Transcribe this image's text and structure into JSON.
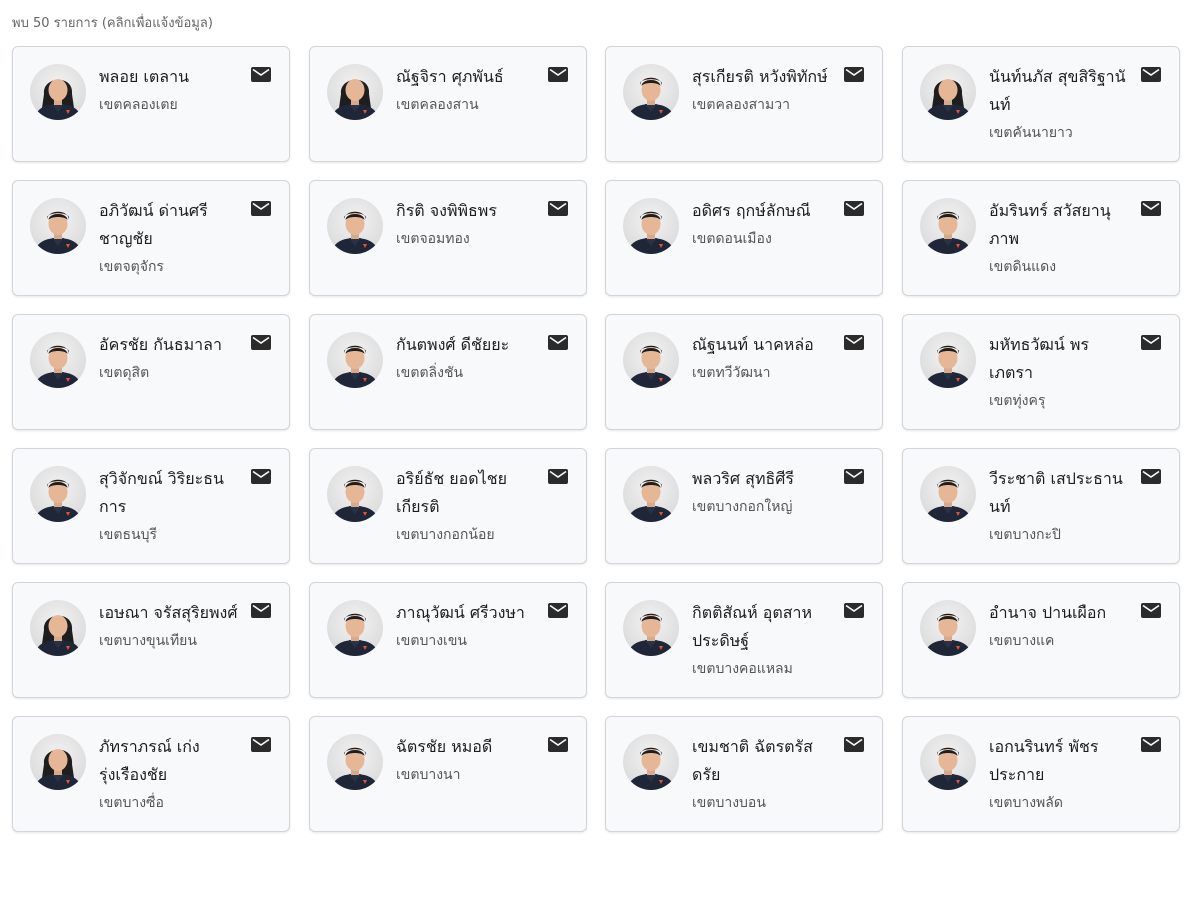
{
  "summary": "พบ 50 รายการ (คลิกเพื่อแจ้งข้อมูล)",
  "icon_names": {
    "contact": "mail-icon",
    "photo": "avatar"
  },
  "members": [
    {
      "name": "พลอย เตลาน",
      "district": "เขตคลองเตย",
      "gender": "f"
    },
    {
      "name": "ณัฐจิรา ศุภพันธ์",
      "district": "เขตคลองสาน",
      "gender": "f"
    },
    {
      "name": "สุรเกียรติ หวังพิทักษ์",
      "district": "เขตคลองสามวา",
      "gender": "m"
    },
    {
      "name": "นันท์นภัส สุขสิริฐานันท์",
      "district": "เขตคันนายาว",
      "gender": "f"
    },
    {
      "name": "อภิวัฒน์ ด่านศรีชาญชัย",
      "district": "เขตจตุจักร",
      "gender": "m"
    },
    {
      "name": "กิรติ จงพิพิธพร",
      "district": "เขตจอมทอง",
      "gender": "m"
    },
    {
      "name": "อดิศร ฤกษ์ลักษณี",
      "district": "เขตดอนเมือง",
      "gender": "m"
    },
    {
      "name": "อัมรินทร์ สวัสยานุภาพ",
      "district": "เขตดินแดง",
      "gender": "m"
    },
    {
      "name": "อัครชัย กันธมาลา",
      "district": "เขตดุสิต",
      "gender": "m"
    },
    {
      "name": "กันตพงศ์ ดีชัยยะ",
      "district": "เขตตลิ่งชัน",
      "gender": "m"
    },
    {
      "name": "ณัฐนนท์ นาคหล่อ",
      "district": "เขตทวีวัฒนา",
      "gender": "m"
    },
    {
      "name": "มหัทธวัฒน์ พรเภตรา",
      "district": "เขตทุ่งครุ",
      "gender": "m"
    },
    {
      "name": "สุวิจักขณ์ วิริยะธนการ",
      "district": "เขตธนบุรี",
      "gender": "m"
    },
    {
      "name": "อริย์ธัช ยอดไชยเกียรติ",
      "district": "เขตบางกอกน้อย",
      "gender": "m"
    },
    {
      "name": "พลวริศ สุทธิศีรี",
      "district": "เขตบางกอกใหญ่",
      "gender": "m"
    },
    {
      "name": "วีระชาติ เสประธานนท์",
      "district": "เขตบางกะปิ",
      "gender": "m"
    },
    {
      "name": "เอษณา จรัสสุริยพงศ์",
      "district": "เขตบางขุนเทียน",
      "gender": "f"
    },
    {
      "name": "ภาณุวัฒน์ ศรีวงษา",
      "district": "เขตบางเขน",
      "gender": "m"
    },
    {
      "name": "กิตติสัณห์ อุตสาหประดิษฐ์",
      "district": "เขตบางคอแหลม",
      "gender": "m"
    },
    {
      "name": "อำนาจ ปานเผือก",
      "district": "เขตบางแค",
      "gender": "m"
    },
    {
      "name": "ภัทราภรณ์ เก่งรุ่งเรืองชัย",
      "district": "เขตบางซื่อ",
      "gender": "f"
    },
    {
      "name": "ฉัตรชัย หมอดี",
      "district": "เขตบางนา",
      "gender": "m"
    },
    {
      "name": "เขมชาติ ฉัตรตรัสดรัย",
      "district": "เขตบางบอน",
      "gender": "m"
    },
    {
      "name": "เอกนรินทร์ พัชรประกาย",
      "district": "เขตบางพลัด",
      "gender": "m"
    }
  ]
}
